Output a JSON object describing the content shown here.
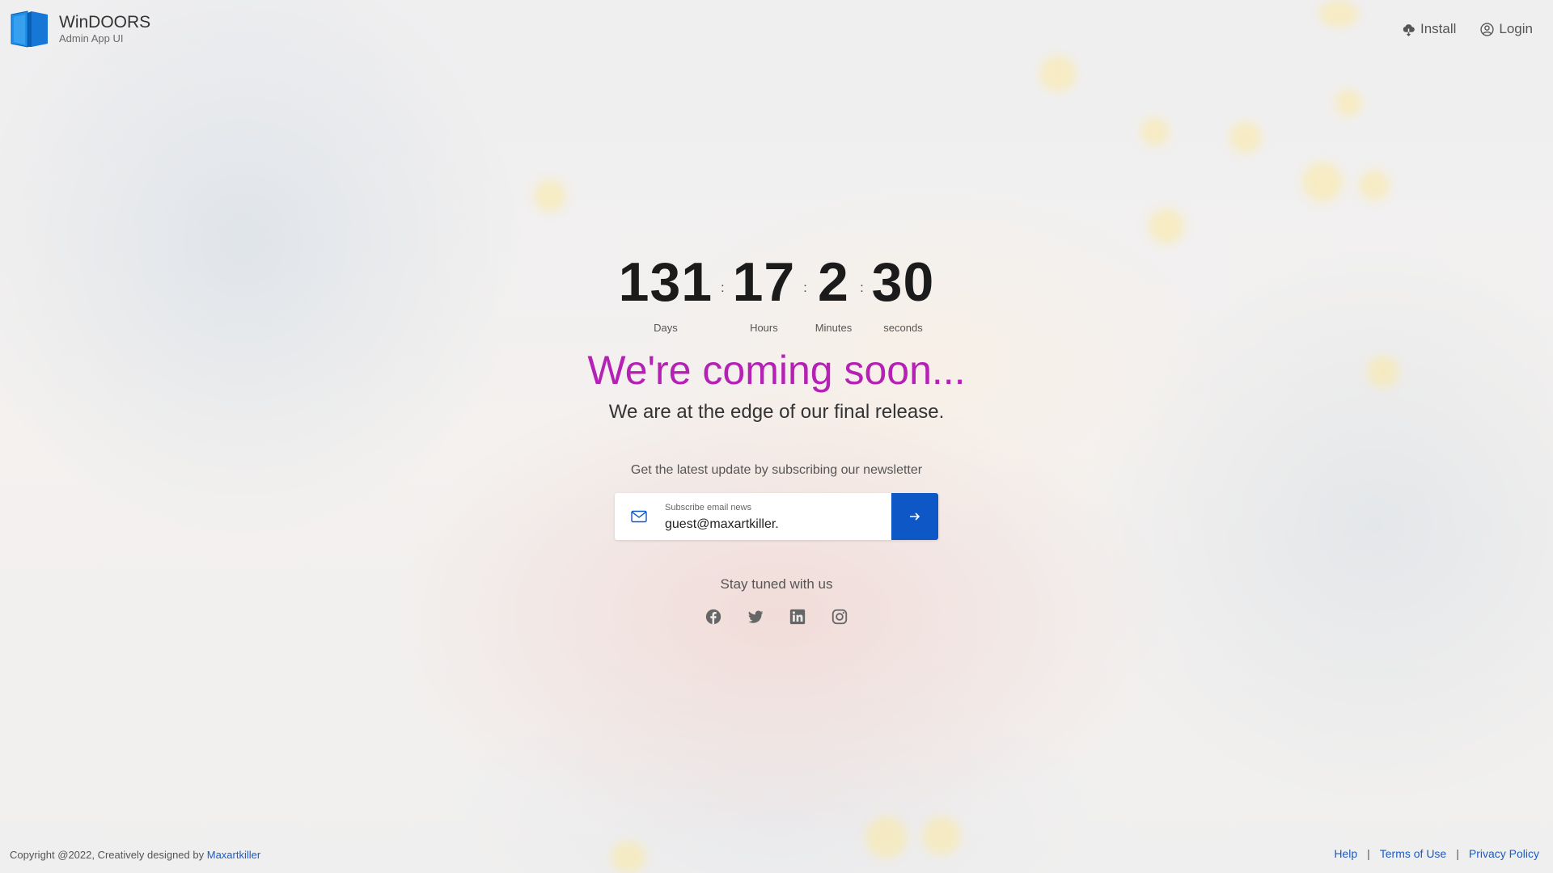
{
  "brand": {
    "name": "WinDOORS",
    "subtitle": "Admin App UI",
    "logo_colors": [
      "#1e90e8",
      "#0a5fb8"
    ]
  },
  "topnav": {
    "install_label": "Install",
    "install_icon": "cloud-download-icon",
    "login_label": "Login",
    "login_icon": "user-circle-icon"
  },
  "countdown": {
    "days": "131",
    "days_label": "Days",
    "hours": "17",
    "hours_label": "Hours",
    "minutes": "2",
    "minutes_label": "Minutes",
    "seconds": "30",
    "seconds_label": "seconds",
    "separator": ":"
  },
  "headline": "We're coming soon...",
  "subline": "We are at the edge of our final release.",
  "newsletter": {
    "text": "Get the latest update by subscribing our newsletter",
    "field_label": "Subscribe email news",
    "field_value": "guest@maxartkiller.",
    "icon": "envelope-icon",
    "button_icon": "arrow-right-icon",
    "button_color": "#0d57c6"
  },
  "stay_tuned": "Stay tuned with us",
  "social": [
    "facebook-icon",
    "twitter-icon",
    "linkedin-icon",
    "instagram-icon"
  ],
  "footer": {
    "copyright": "Copyright @2022, Creatively designed by",
    "author_link": "Maxartkiller",
    "links": {
      "help": "Help",
      "terms": "Terms of Use",
      "privacy": "Privacy Policy"
    },
    "divider": "|"
  },
  "colors": {
    "headline": "#b521b4",
    "link": "#1a5bc4"
  }
}
